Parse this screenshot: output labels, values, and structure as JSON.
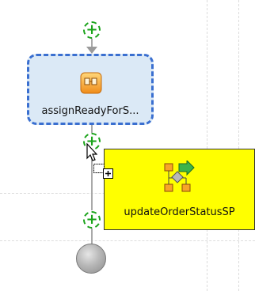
{
  "activity": {
    "label": "assignReadyForS...",
    "icon": "assign-activity-icon"
  },
  "tooltip": {
    "label": "updateOrderStatusSP",
    "icon": "service-invoke-icon"
  },
  "add_nodes": [
    {
      "symbol": "+"
    },
    {
      "symbol": "+"
    },
    {
      "symbol": "+"
    }
  ],
  "colors": {
    "selection_border": "#3a6fd0",
    "activity_fill": "#dbe9f6",
    "tooltip_fill": "#ffff00",
    "add_node": "#1aa31a"
  }
}
